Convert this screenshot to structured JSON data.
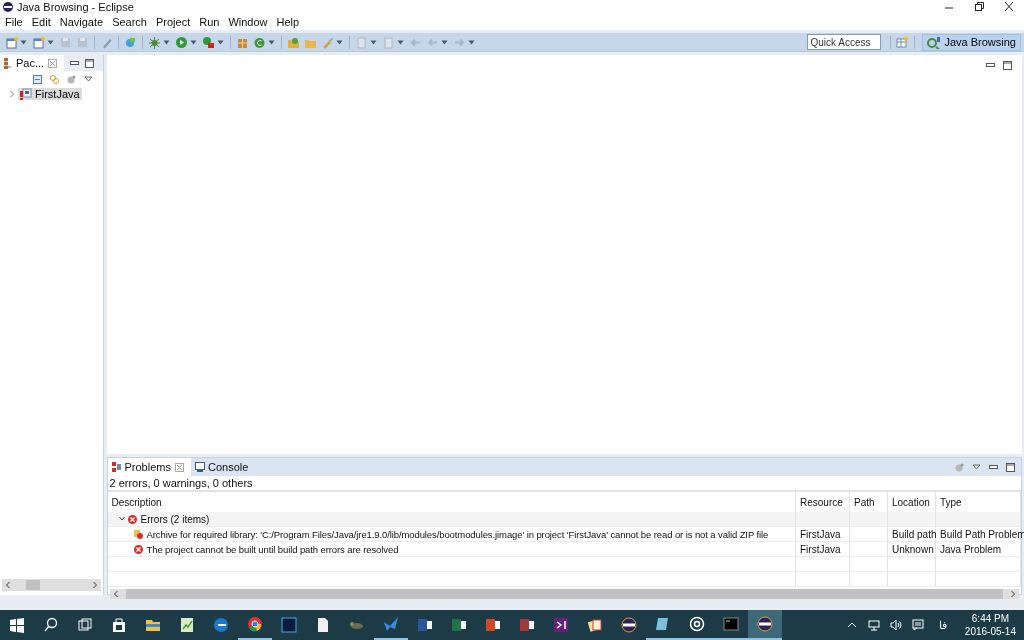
{
  "window": {
    "title": "Java Browsing - Eclipse"
  },
  "menu": [
    "File",
    "Edit",
    "Navigate",
    "Search",
    "Project",
    "Run",
    "Window",
    "Help"
  ],
  "toolbar": {
    "quick_access": {
      "placeholder": "Quick Access"
    },
    "perspective": {
      "label": "Java Browsing",
      "selected": true
    }
  },
  "left_view": {
    "tab": {
      "label": "Pac...",
      "selected": true
    },
    "tree": [
      {
        "label": "FirstJava",
        "expanded": false,
        "selected": true
      }
    ]
  },
  "bottom_view": {
    "tabs": [
      {
        "label": "Problems",
        "selected": true,
        "kind": "problems"
      },
      {
        "label": "Console",
        "selected": false,
        "kind": "console"
      }
    ],
    "summary": "2 errors, 0 warnings, 0 others",
    "columns": [
      "Description",
      "Resource",
      "Path",
      "Location",
      "Type"
    ],
    "groups": [
      {
        "label": "Errors (2 items)",
        "expanded": true,
        "children": [
          {
            "kind": "library-error",
            "description": "Archive for required library: 'C:/Program Files/Java/jre1.9.0/lib/modules/bootmodules.jimage' in project 'FirstJava' cannot be read or is not a valid ZIP file",
            "resource": "FirstJava",
            "location": "Build path",
            "type": "Build Path Problem"
          },
          {
            "kind": "error",
            "description": "The project cannot be built until build path errors are resolved",
            "resource": "FirstJava",
            "location": "Unknown",
            "type": "Java Problem"
          }
        ]
      }
    ]
  },
  "taskbar": {
    "apps": [
      {
        "kind": "explorer",
        "running": false
      },
      {
        "kind": "sheet",
        "running": false
      },
      {
        "kind": "edge",
        "running": false
      },
      {
        "kind": "chrome",
        "running": true
      },
      {
        "kind": "photoshop",
        "running": false
      },
      {
        "kind": "file",
        "running": false
      },
      {
        "kind": "gecko",
        "running": false
      },
      {
        "kind": "bird",
        "running": true
      },
      {
        "kind": "word",
        "running": false
      },
      {
        "kind": "excel",
        "running": false
      },
      {
        "kind": "powerpoint",
        "running": false
      },
      {
        "kind": "access",
        "running": false
      },
      {
        "kind": "studio",
        "running": false
      },
      {
        "kind": "cards",
        "running": false
      },
      {
        "kind": "eclipse",
        "running": false
      },
      {
        "kind": "pad",
        "running": true
      },
      {
        "kind": "groove",
        "running": true
      },
      {
        "kind": "terminal",
        "running": true
      },
      {
        "kind": "eclipse",
        "running": true,
        "selected": true
      }
    ],
    "language": "فا",
    "time": "6:44 PM",
    "date": "2016-05-14"
  }
}
